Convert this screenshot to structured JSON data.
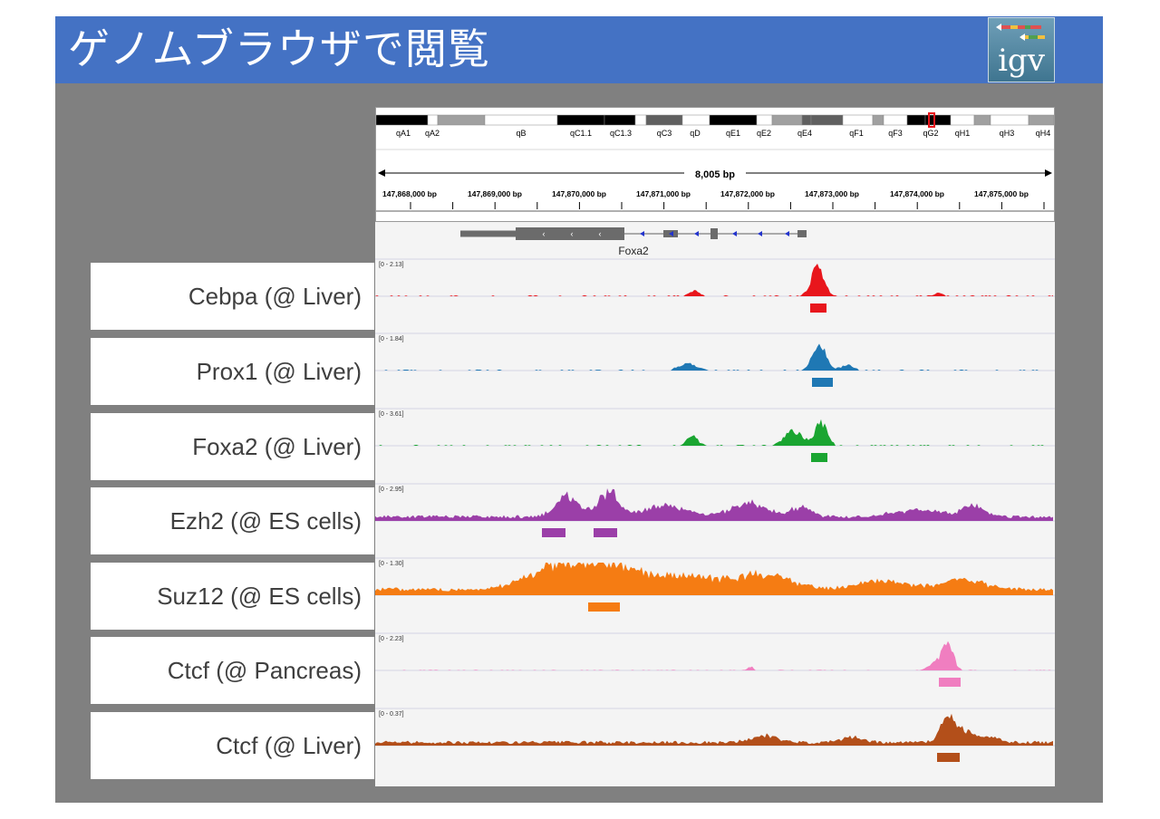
{
  "slide": {
    "title": "ゲノムブラウザで閲覧"
  },
  "logo": {
    "text": "igv",
    "stripe_colors": [
      "#e05050",
      "#f0c040",
      "#50a050",
      "#4080d0"
    ]
  },
  "ideogram": {
    "bands": [
      "qA1",
      "qA2",
      "qB",
      "qC1.1",
      "qC1.3",
      "qC3",
      "qD",
      "qE1",
      "qE2",
      "qE4",
      "qF1",
      "qF3",
      "qG2",
      "qH1",
      "qH3",
      "qH4"
    ]
  },
  "ruler": {
    "span_label": "8,005 bp",
    "ticks": [
      "147,868,000 bp",
      "147,869,000 bp",
      "147,870,000 bp",
      "147,871,000 bp",
      "147,872,000 bp",
      "147,873,000 bp",
      "147,874,000 bp",
      "147,875,000 bp"
    ]
  },
  "gene": {
    "name": "Foxa2"
  },
  "tracks": [
    {
      "label": "Cebpa (@ Liver)",
      "range": "[0 - 2.13]",
      "color": "#e8161c"
    },
    {
      "label": "Prox1 (@ Liver)",
      "range": "[0 - 1.84]",
      "color": "#1f78b4"
    },
    {
      "label": "Foxa2 (@ Liver)",
      "range": "[0 - 3.61]",
      "color": "#1aa531"
    },
    {
      "label": "Ezh2 (@ ES cells)",
      "range": "[0 - 2.95]",
      "color": "#9b3fa8"
    },
    {
      "label": "Suz12 (@ ES cells)",
      "range": "[0 - 1.30]",
      "color": "#f57c13"
    },
    {
      "label": "Ctcf (@ Pancreas)",
      "range": "[0 - 2.23]",
      "color": "#f07ec0"
    },
    {
      "label": "Ctcf (@ Liver)",
      "range": "[0 - 0.37]",
      "color": "#b34f1a"
    }
  ]
}
